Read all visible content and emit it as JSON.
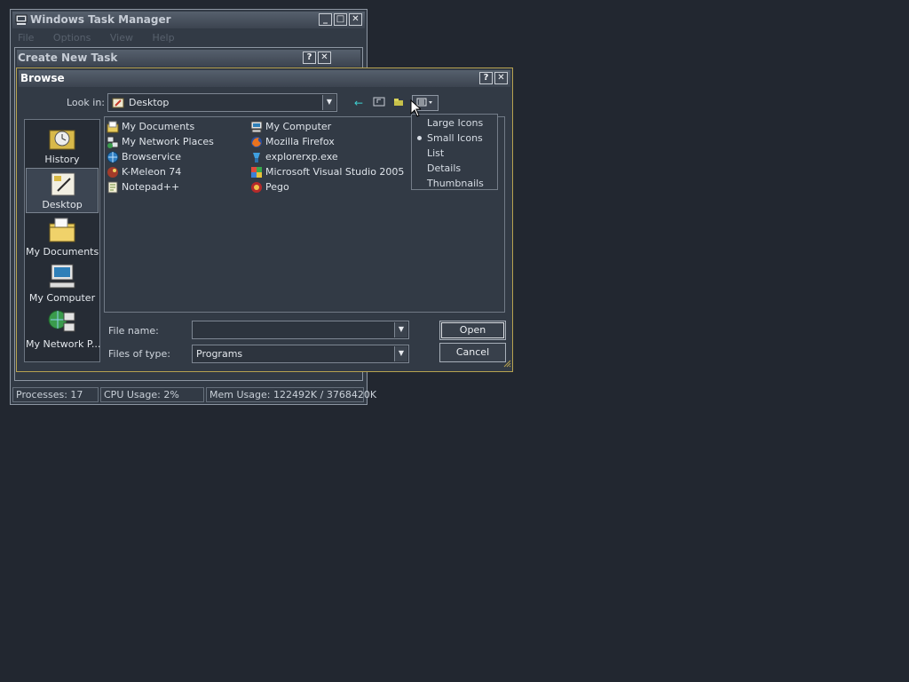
{
  "task_manager": {
    "title": "Windows Task Manager",
    "menu": [
      "File",
      "Options",
      "View",
      "Help"
    ],
    "status": {
      "processes": "Processes: 17",
      "cpu": "CPU Usage: 2%",
      "mem": "Mem Usage: 122492K / 3768420K"
    }
  },
  "create_task": {
    "title": "Create New Task"
  },
  "browse": {
    "title": "Browse",
    "look_in_label": "Look in:",
    "look_in_value": "Desktop",
    "places": [
      "History",
      "Desktop",
      "My Documents",
      "My Computer",
      "My Network P..."
    ],
    "files_col1": [
      "My Documents",
      "My Network Places",
      "Browservice",
      "K-Meleon 74",
      "Notepad++"
    ],
    "files_col2": [
      "My Computer",
      "Mozilla Firefox",
      "explorerxp.exe",
      "Microsoft Visual Studio 2005",
      "Pego"
    ],
    "file_name_label": "File name:",
    "file_name_value": "",
    "files_of_type_label": "Files of type:",
    "files_of_type_value": "Programs",
    "open_label": "Open",
    "cancel_label": "Cancel"
  },
  "view_menu": {
    "items": [
      "Large Icons",
      "Small Icons",
      "List",
      "Details",
      "Thumbnails"
    ],
    "selected": "Small Icons"
  },
  "title_buttons": {
    "minimize": "_",
    "maximize": "□",
    "close": "✕",
    "help": "?"
  },
  "colors": {
    "desktop": "#222730",
    "window": "#323a45",
    "dialog_border": "#b7a24f"
  }
}
